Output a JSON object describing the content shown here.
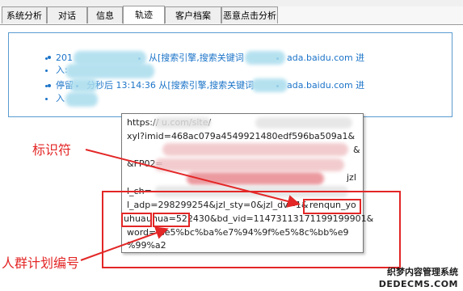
{
  "tabs": [
    {
      "label": "系统分析"
    },
    {
      "label": "对话"
    },
    {
      "label": "信息"
    },
    {
      "label": "轨迹"
    },
    {
      "label": "客户档案"
    },
    {
      "label": "恶意点击分析"
    }
  ],
  "active_tab": "轨迹",
  "track": {
    "items": [
      {
        "line1_prefix": "201",
        "line1_middle": "从[搜索引擎,搜索关键词",
        "line1_suffix": "ada.baidu.com 进",
        "line2": "入:"
      },
      {
        "line1_prefix": "停留",
        "line1_middle": "分秒后 13:14:36 从[搜索引擎,搜索关键词",
        "line1_suffix": "ada.baidu.com 进",
        "line2": "入"
      }
    ]
  },
  "tooltip": {
    "lines": [
      "https://           u.com/site/",
      "xyl?imid=468ac079a4549921480edf596ba509a1&",
      "&",
      "&FP02=",
      "jzl",
      "l_ch=",
      "l_adp=298299254&jzl_sty=0&jzl_dv=1&",
      "uhua=522430&bd_vid=11473113171199199901&",
      "word=%e5%bc%ba%e7%94%9f%e5%8c%bb%e9",
      "%99%a2"
    ],
    "renqun_part1": "renqun_yo",
    "renqun_part2": "uhua",
    "id_value": "522430"
  },
  "annotations": {
    "identifier": "标识符",
    "group_plan": "人群计划编号"
  },
  "watermark": {
    "line1": "织梦内容管理系统",
    "line2": "DEDECMS.COM"
  },
  "colors": {
    "link": "#1a73c8",
    "annotation": "#e32626",
    "panel_border": "#5a9bd0"
  }
}
